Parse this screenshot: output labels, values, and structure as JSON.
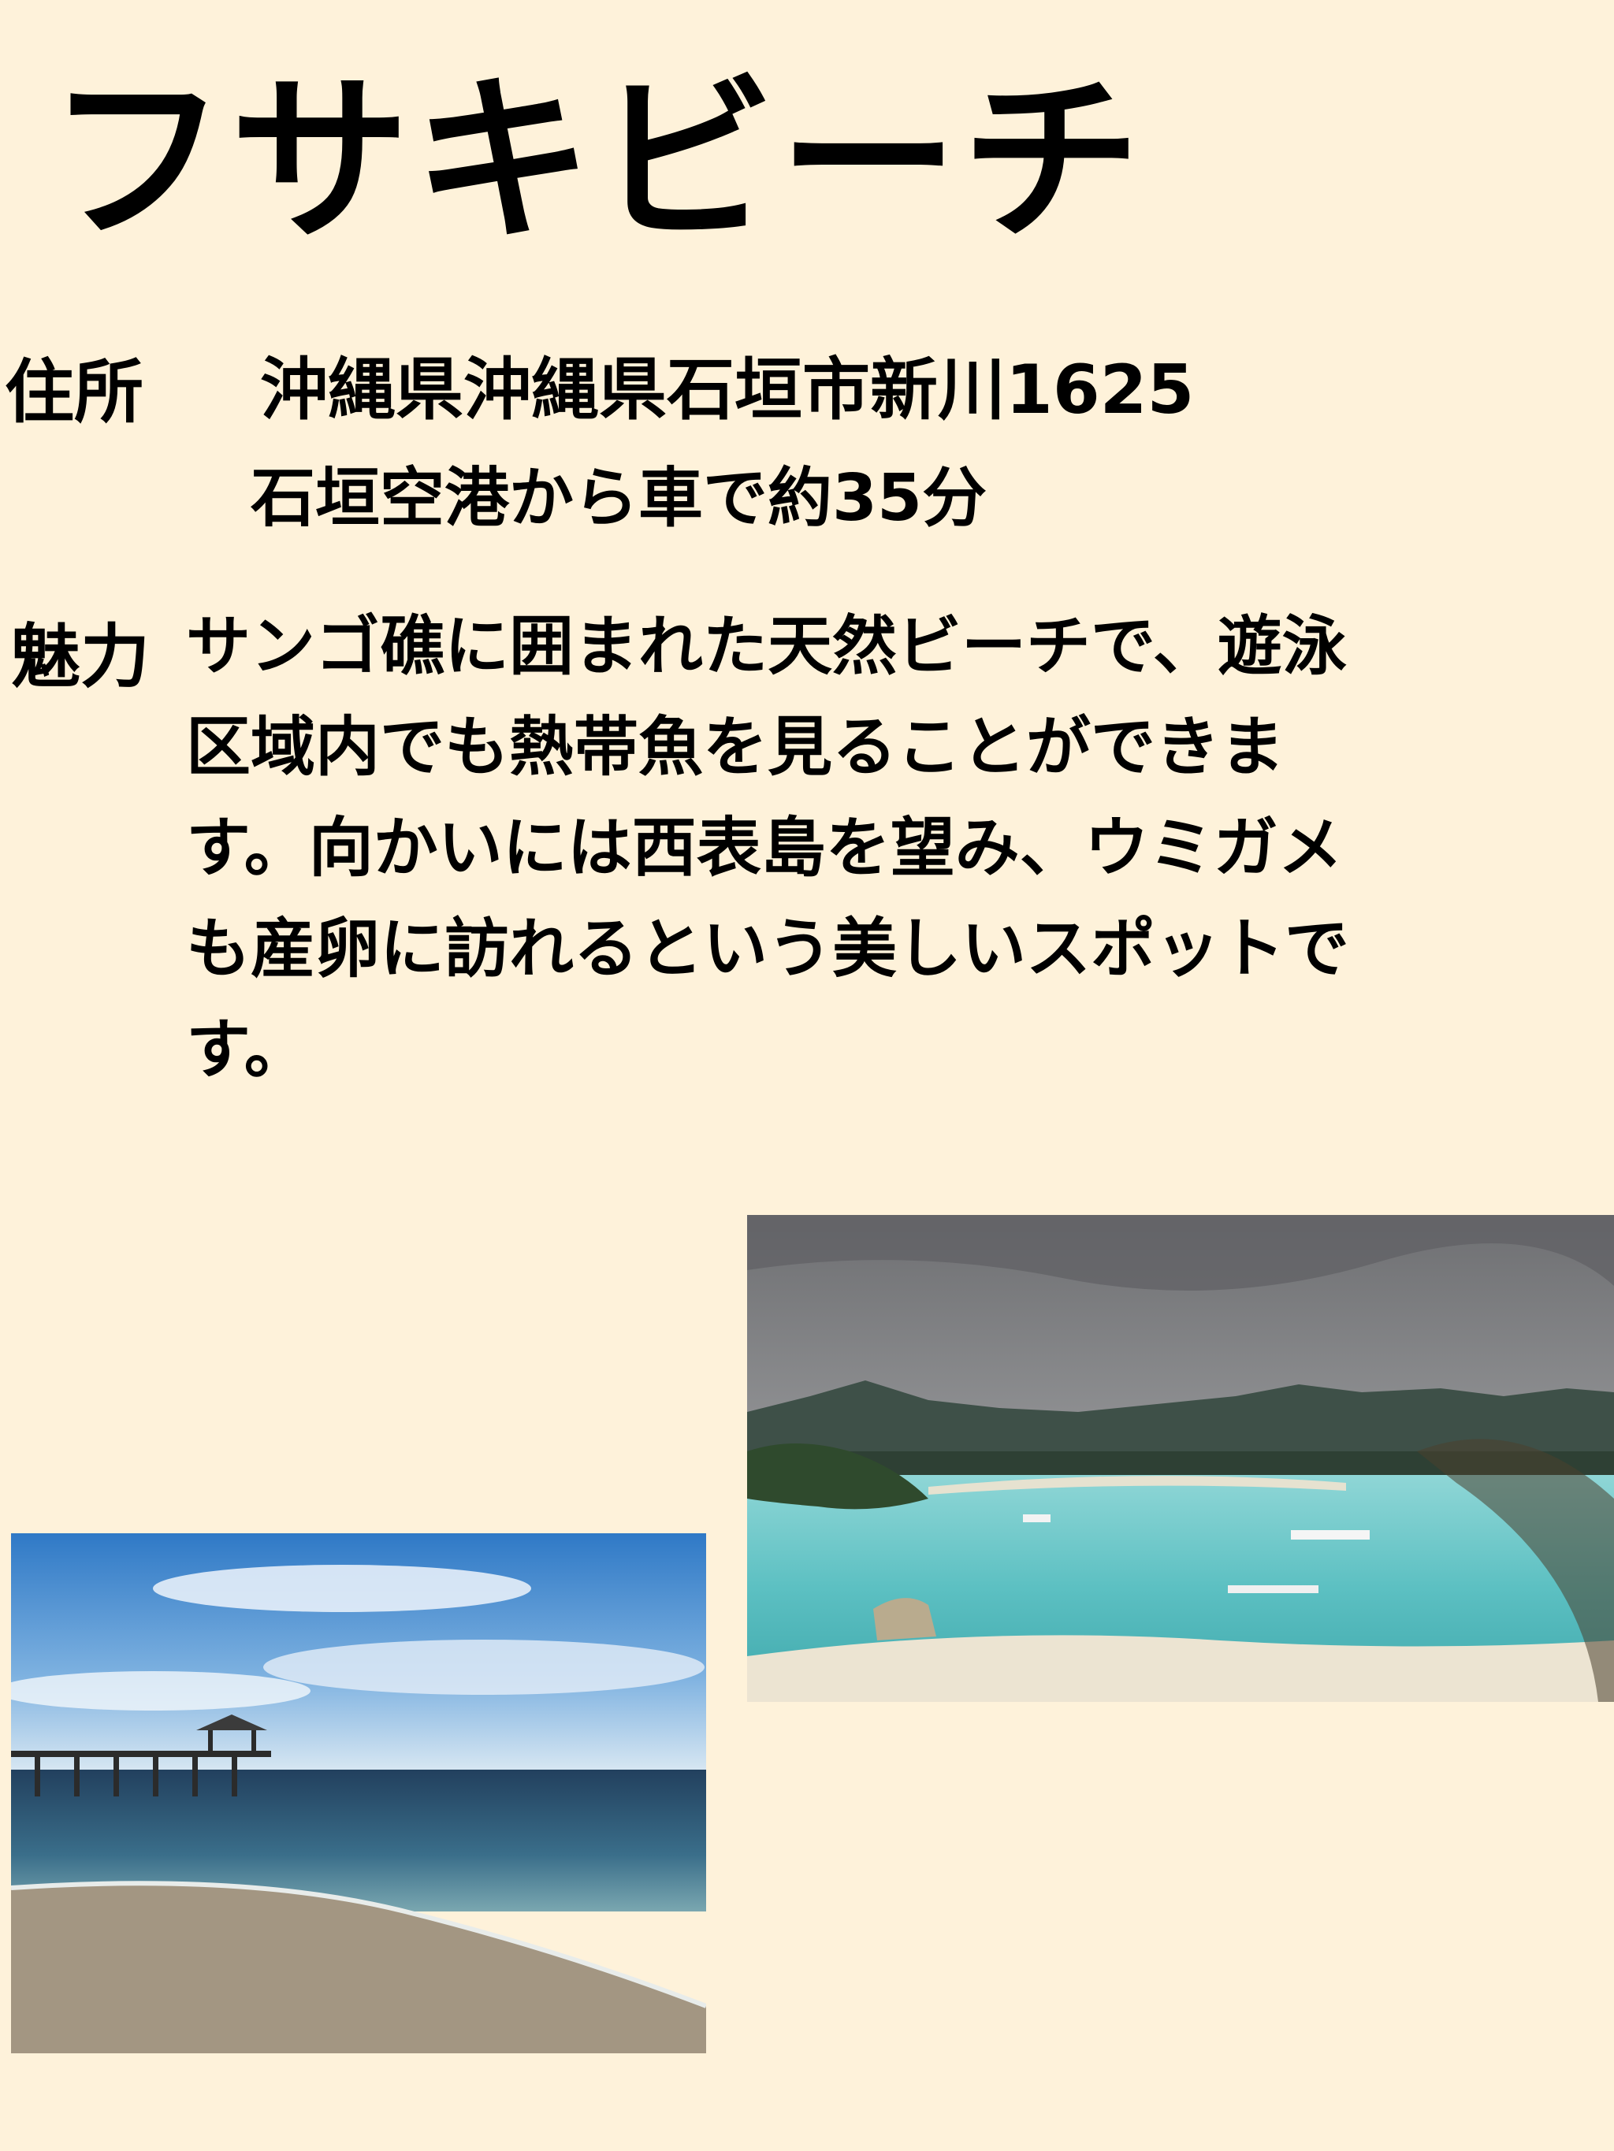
{
  "title": "フサキビーチ",
  "address": {
    "label": "住所",
    "value": "沖縄県沖縄県石垣市新川1625",
    "access": "石垣空港から車で約35分"
  },
  "charm": {
    "label": "魅力",
    "lines": [
      "サンゴ礁に囲まれた天然ビーチで、遊泳",
      "区域内でも熱帯魚を見ることができま",
      "す。向かいには西表島を望み、ウミガメ",
      "も産卵に訪れるという美しいスポットで",
      "す。"
    ]
  },
  "photos": [
    {
      "name": "bay-with-boats-photo"
    },
    {
      "name": "pier-beach-photo"
    }
  ]
}
